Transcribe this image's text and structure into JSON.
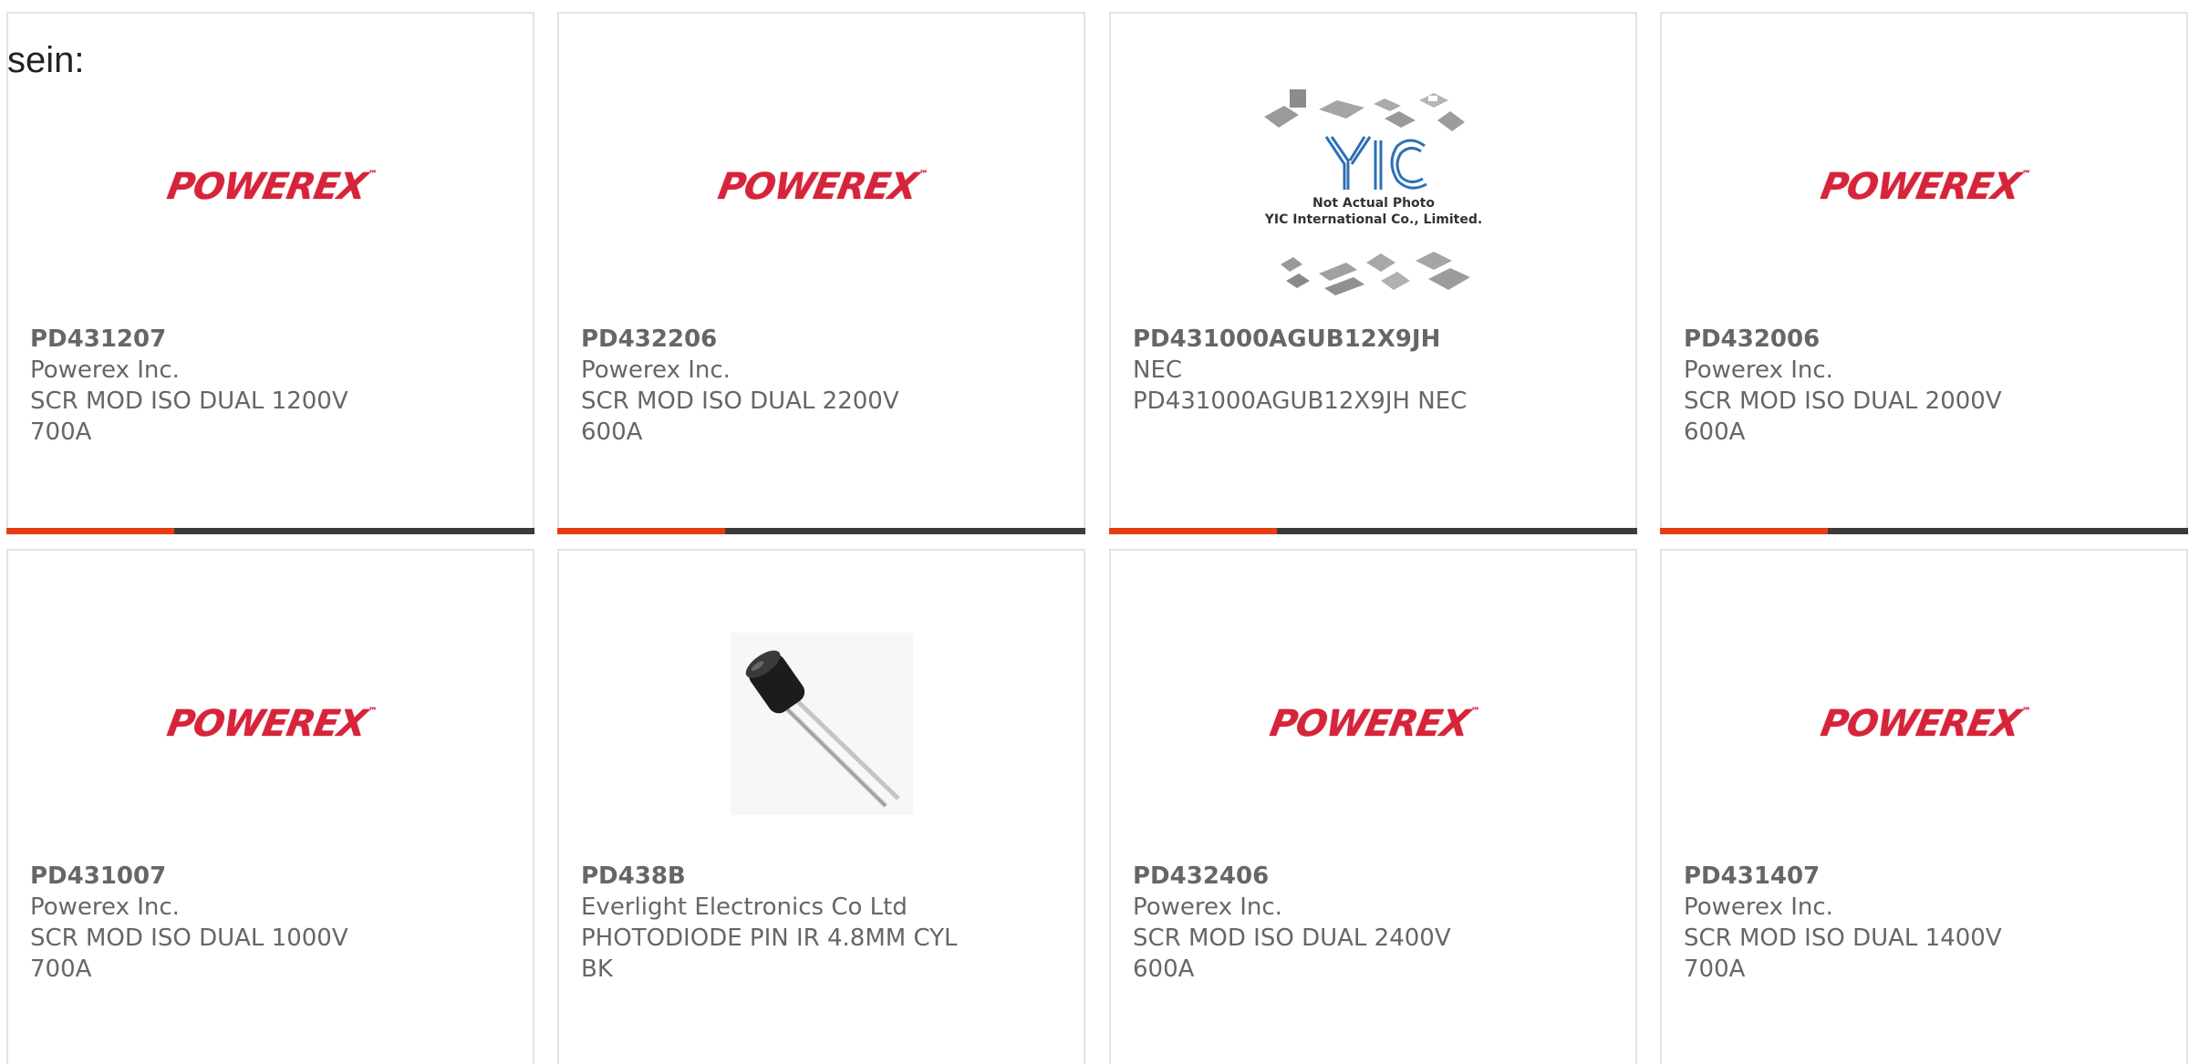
{
  "heading": "sein:",
  "colors": {
    "accent_bar": "#e83d12",
    "bar": "#3b3b3b",
    "text": "#666666",
    "powerex_red": "#d6243a"
  },
  "products": [
    {
      "part": "PD431207",
      "maker": "Powerex Inc.",
      "desc": "SCR MOD ISO DUAL 1200V 700A",
      "image": "powerex-logo",
      "logo_text": "POWEREX"
    },
    {
      "part": "PD432206",
      "maker": "Powerex Inc.",
      "desc": "SCR MOD ISO DUAL 2200V 600A",
      "image": "powerex-logo",
      "logo_text": "POWEREX"
    },
    {
      "part": "PD431000AGUB12X9JH",
      "maker": "NEC",
      "desc": "PD431000AGUB12X9JH NEC",
      "image": "yic-placeholder",
      "logo_text": "YIC",
      "note_line1": "Not Actual Photo",
      "note_line2": "YIC International Co., Limited."
    },
    {
      "part": "PD432006",
      "maker": "Powerex Inc.",
      "desc": "SCR MOD ISO DUAL 2000V 600A",
      "image": "powerex-logo",
      "logo_text": "POWEREX"
    },
    {
      "part": "PD431007",
      "maker": "Powerex Inc.",
      "desc": "SCR MOD ISO DUAL 1000V 700A",
      "image": "powerex-logo",
      "logo_text": "POWEREX"
    },
    {
      "part": "PD438B",
      "maker": "Everlight Electronics Co Ltd",
      "desc": "PHOTODIODE PIN IR 4.8MM CYL BK",
      "image": "photodiode-photo"
    },
    {
      "part": "PD432406",
      "maker": "Powerex Inc.",
      "desc": "SCR MOD ISO DUAL 2400V 600A",
      "image": "powerex-logo",
      "logo_text": "POWEREX"
    },
    {
      "part": "PD431407",
      "maker": "Powerex Inc.",
      "desc": "SCR MOD ISO DUAL 1400V 700A",
      "image": "powerex-logo",
      "logo_text": "POWEREX"
    }
  ]
}
